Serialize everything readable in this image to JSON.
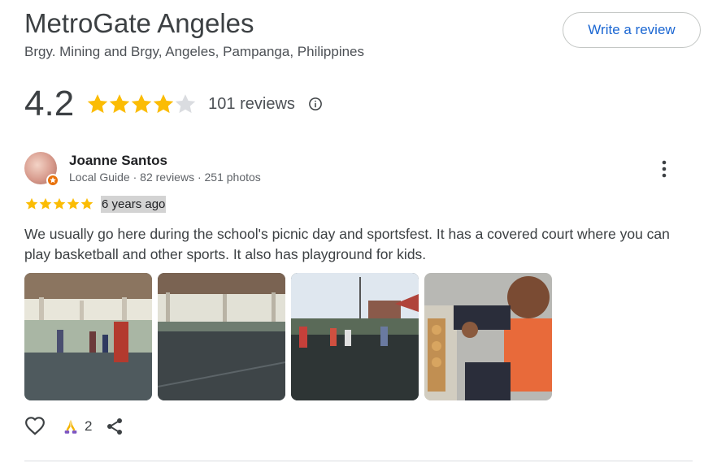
{
  "place": {
    "title": "MetroGate Angeles",
    "address": "Brgy. Mining and Brgy, Angeles, Pampanga, Philippines",
    "write_review_label": "Write a review"
  },
  "rating": {
    "value": "4.2",
    "stars_filled": 4,
    "stars_total": 5,
    "reviews_label": "101 reviews",
    "info_icon": "info-icon"
  },
  "review": {
    "reviewer_name": "Joanne Santos",
    "reviewer_meta": "Local Guide · 82 reviews · 251 photos",
    "stars": 5,
    "date": "6 years ago",
    "text": "We usually go here during the school's picnic day and sportsfest. It has a covered court where you can play basketball and other sports. It also has playground for kids.",
    "photo_count": 4,
    "reaction_count": "2",
    "icons": [
      "more-vert-icon",
      "heart-icon",
      "praying-hands-icon",
      "share-icon"
    ]
  },
  "colors": {
    "star": "#fbbc04",
    "star_empty": "#dadce0",
    "link": "#1a66d2",
    "local_guide_badge": "#e8710a"
  }
}
